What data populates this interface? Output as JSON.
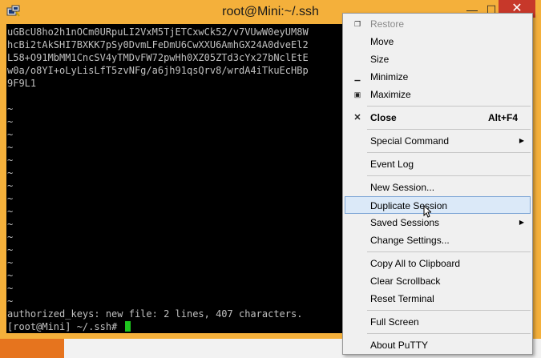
{
  "window": {
    "title": "root@Mini:~/.ssh",
    "controls": {
      "minimize": "—",
      "maximize": "☐",
      "close": "✕"
    }
  },
  "terminal": {
    "lines": [
      "uGBcU8ho2h1nOCm0URpuLI2VxM5TjETCxwCk52/v7VUwW0eyUM8W",
      "hcBi2tAkSHI7BXKK7pSy0DvmLFeDmU6CwXXU6AmhGX24A0dveEl2",
      "L58+O91MbMM1CncSV4yTMDvFW72pwHh0XZ05ZTd3cYx27bNclEtE",
      "w0a/o8YI+oLyLisLfT5zvNFg/a6jh91qsQrv8/wrdA4iTkuEcHBp",
      "9F9L1"
    ],
    "tilde": "~",
    "status_line": "authorized_keys: new file: 2 lines, 407 characters.",
    "prompt": "[root@Mini] ~/.ssh# "
  },
  "menu": {
    "restore": "Restore",
    "move": "Move",
    "size": "Size",
    "minimize": "Minimize",
    "maximize": "Maximize",
    "close": "Close",
    "close_shortcut": "Alt+F4",
    "special_command": "Special Command",
    "event_log": "Event Log",
    "new_session": "New Session...",
    "duplicate_session": "Duplicate Session",
    "saved_sessions": "Saved Sessions",
    "change_settings": "Change Settings...",
    "copy_all": "Copy All to Clipboard",
    "clear_scrollback": "Clear Scrollback",
    "reset_terminal": "Reset Terminal",
    "full_screen": "Full Screen",
    "about": "About PuTTY"
  },
  "colors": {
    "title_bar": "#f4b03b",
    "close_button": "#c7382a",
    "terminal_bg": "#000000",
    "cursor": "#1ec51e",
    "menu_bg": "#f0f0f0",
    "menu_hover": "#dbe9f8"
  }
}
